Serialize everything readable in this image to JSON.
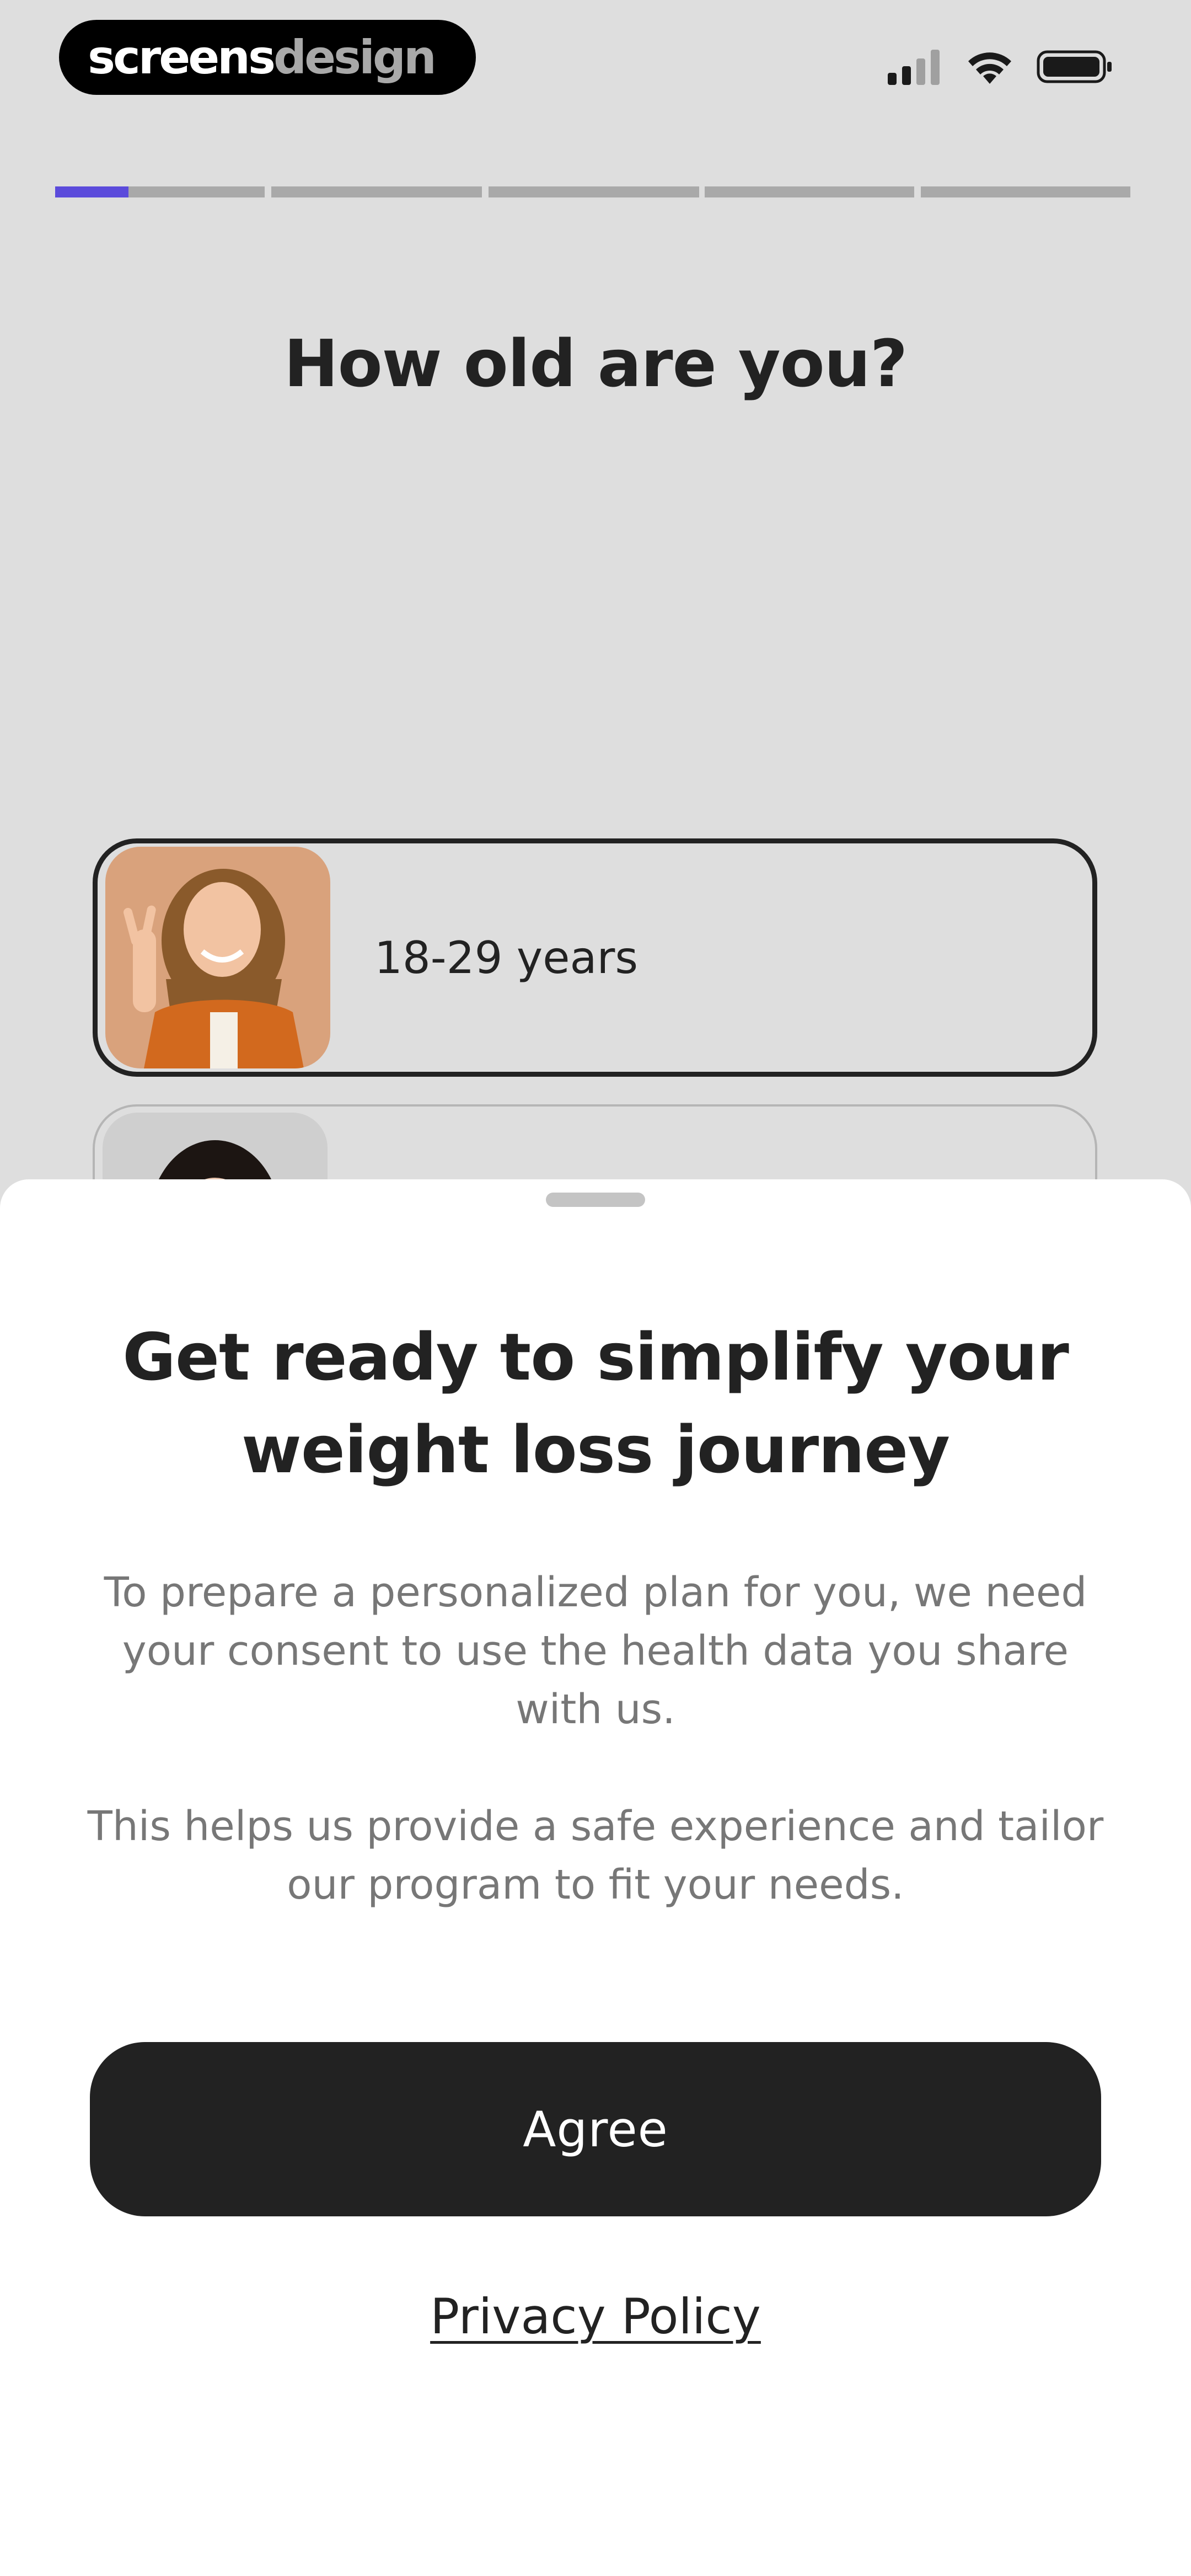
{
  "status_bar": {
    "brand_part1": "screens",
    "brand_part2": "design",
    "icons": [
      "signal-icon",
      "wifi-icon",
      "battery-icon"
    ]
  },
  "progress": {
    "total_steps": 6,
    "current_step": 1,
    "first_step_fill_fraction": 0.35,
    "active_color": "#5b4bdb",
    "inactive_color": "#a9a9a9"
  },
  "question": {
    "title": "How old are you?"
  },
  "options": [
    {
      "label": "18-29 years",
      "selected": true,
      "image": "smiling-woman-peace-sign"
    },
    {
      "label": "",
      "selected": false,
      "image": "woman-portrait"
    }
  ],
  "sheet": {
    "title": "Get ready to simplify your weight loss journey",
    "paragraph1": "To prepare a personalized plan for you, we need your consent to use the health data you share with us.",
    "paragraph2": "This helps us provide a safe experience and tailor our program to fit your needs.",
    "agree_label": "Agree",
    "privacy_label": "Privacy Policy"
  },
  "colors": {
    "background": "#dedede",
    "sheet": "#ffffff",
    "primary_button": "#222222",
    "accent": "#5b4bdb"
  }
}
